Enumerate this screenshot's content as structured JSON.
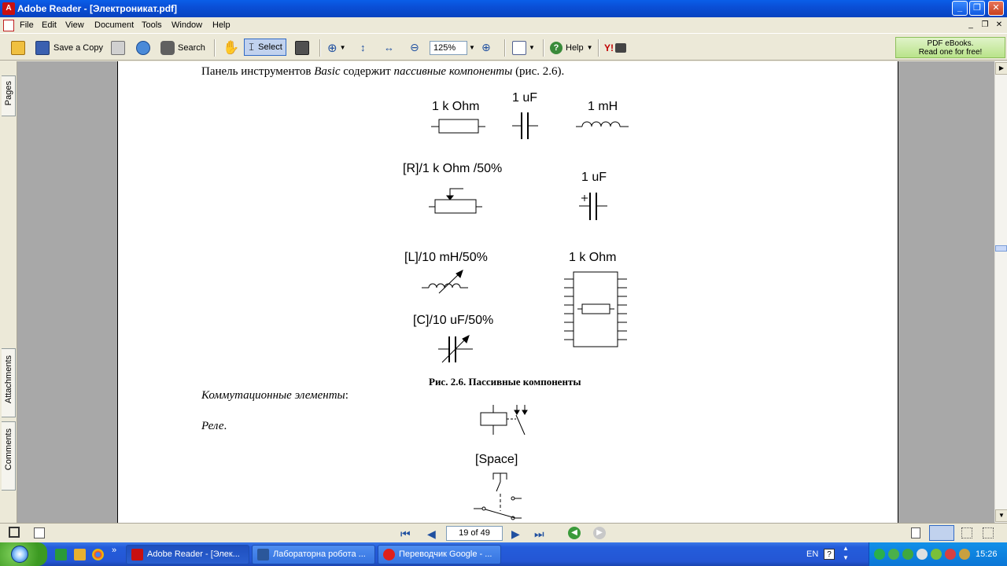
{
  "window": {
    "title": "Adobe Reader - [Электроникат.pdf]"
  },
  "menu": [
    "File",
    "Edit",
    "View",
    "Document",
    "Tools",
    "Window",
    "Help"
  ],
  "toolbar": {
    "save_copy": "Save a Copy",
    "search": "Search",
    "select": "Select",
    "zoom": "125%",
    "help": "Help",
    "ad_line1": "PDF eBooks.",
    "ad_line2": "Read one for free!"
  },
  "nav_tabs": {
    "pages": "Pages",
    "attachments": "Attachments",
    "comments": "Comments"
  },
  "doc": {
    "intro_prefix": "Панель инструментов ",
    "intro_basic": "Basic",
    "intro_mid": " содержит ",
    "intro_passive": "пассивные компоненты",
    "intro_suffix": " (рис. 2.6).",
    "labels": {
      "resistor": "1 k Ohm",
      "capacitor": "1 uF",
      "inductor": "1 mH",
      "potentiometer": "[R]/1 k Ohm /50%",
      "polar_capacitor": "1 uF",
      "var_inductor": "[L]/10 mH/50%",
      "resistor_pack": "1 k Ohm",
      "var_capacitor": "[C]/10 uF/50%",
      "switch_key": "[Space]"
    },
    "figure_caption": "Рис. 2.6. Пассивные компоненты",
    "switching": "Коммутационные элементы",
    "switching_colon": ":",
    "relay": "Реле",
    "relay_dot": "."
  },
  "status": {
    "page": "19 of 49"
  },
  "taskbar": {
    "tasks": [
      {
        "label": "Adobe Reader - [Элек...",
        "color": "#c81010"
      },
      {
        "label": "Лабораторна робота ...",
        "color": "#2b579a"
      },
      {
        "label": "Переводчик Google - ...",
        "color": "#e0201c"
      }
    ],
    "lang": "EN",
    "clock": "15:26"
  }
}
